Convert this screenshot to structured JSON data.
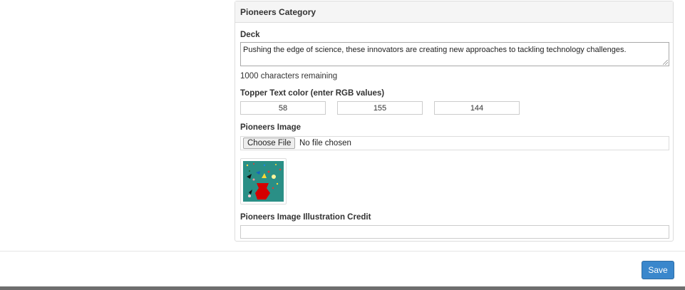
{
  "panel": {
    "title": "Pioneers Category"
  },
  "deck": {
    "label": "Deck",
    "value": "Pushing the edge of science, these innovators are creating new approaches to tackling technology challenges.",
    "remaining": "1000 characters remaining"
  },
  "topper": {
    "label": "Topper Text color (enter RGB values)",
    "r": "58",
    "g": "155",
    "b": "144"
  },
  "image": {
    "label": "Pioneers Image",
    "choose_label": "Choose File",
    "file_status": "No file chosen",
    "thumbnail_bg": "#2a8f86"
  },
  "credit": {
    "label": "Pioneers Image Illustration Credit",
    "value": ""
  },
  "footer": {
    "save_label": "Save",
    "save_color": "#3a87cc"
  }
}
